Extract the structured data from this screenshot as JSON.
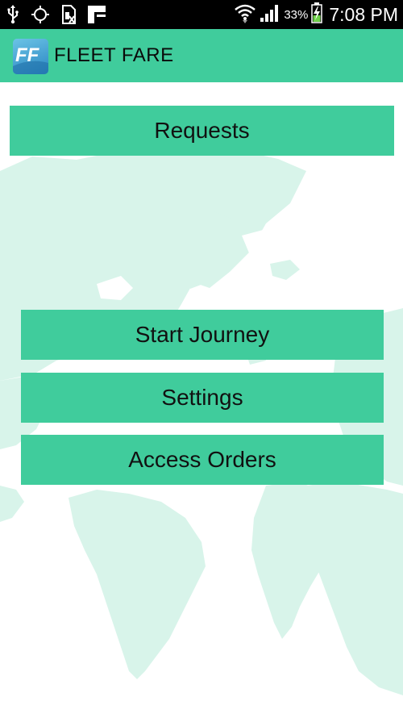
{
  "status_bar": {
    "battery_percent": "33%",
    "time": "7:08 PM",
    "icons": [
      "usb-icon",
      "gps-icon",
      "sim-card-icon",
      "notification-icon",
      "wifi-icon",
      "signal-icon",
      "battery-charging-icon"
    ]
  },
  "action_bar": {
    "logo_text": "FF",
    "title": "FLEET FARE"
  },
  "menu": {
    "requests": "Requests",
    "start_journey": "Start Journey",
    "settings": "Settings",
    "access_orders": "Access Orders"
  },
  "colors": {
    "accent": "#40cc9c",
    "map_land": "#d8f4ea",
    "status_bar": "#000000",
    "button_text": "#111111"
  }
}
